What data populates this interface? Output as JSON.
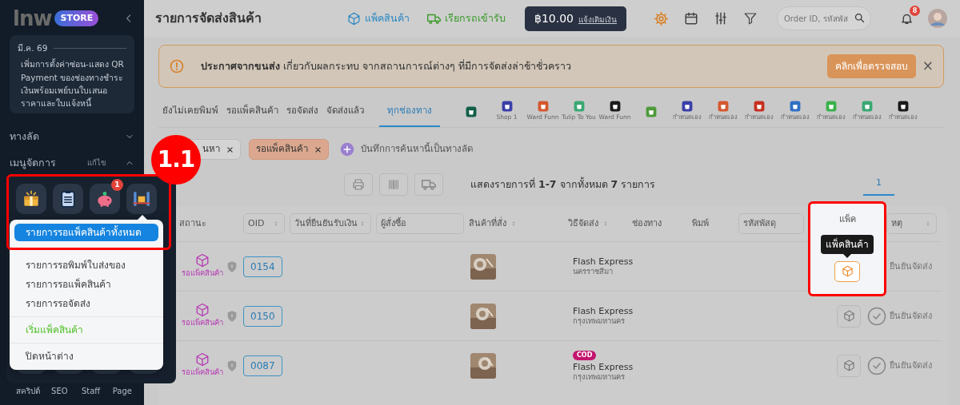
{
  "sidebar": {
    "logo": {
      "wordmark": "lnw",
      "badge": "STORE"
    },
    "news": {
      "date": "มี.ค. 69",
      "text": "เพิ่มการตั้งค่าซ่อน-แสดง QR Payment ของช่องทางชำระเงินพร้อมเพย์บนใบเสนอราคาและใบแจ้งหนี้"
    },
    "sections": [
      {
        "label": "ทางลัด",
        "expanded": false
      },
      {
        "label": "เมนูจัดการ",
        "action": "แก้ไข",
        "expanded": true
      }
    ],
    "menu_tiles": [
      {
        "kind": "gift"
      },
      {
        "kind": "clipboard"
      },
      {
        "kind": "piggy",
        "badge": "1"
      },
      {
        "kind": "station"
      }
    ],
    "bottom_items": [
      {
        "label": "สคริปต์"
      },
      {
        "label": "SEO"
      },
      {
        "label": "Staff"
      },
      {
        "label": "Page"
      }
    ]
  },
  "popup_menu": [
    {
      "label": "รายการรอแพ็คสินค้าทั้งหมด",
      "kind": "item",
      "selected": true
    },
    {
      "label": "รายการรอพิมพ์ใบส่งของ",
      "kind": "item",
      "selected": false
    },
    {
      "label": "รายการรอแพ็คสินค้า",
      "kind": "item",
      "selected": false
    },
    {
      "label": "รายการรอจัดส่ง",
      "kind": "item",
      "selected": false
    },
    {
      "label": "เริ่มแพ็คสินค้า",
      "kind": "action",
      "selected": false
    },
    {
      "label": "ปิดหน้าต่าง",
      "kind": "close",
      "selected": false
    }
  ],
  "callout": {
    "label": "1.1"
  },
  "header": {
    "title": "รายการจัดส่งสินค้า",
    "links": [
      {
        "label": "แพ็คสินค้า",
        "kind": "pack"
      },
      {
        "label": "เรียกรถเข้ารับ",
        "kind": "pickup"
      }
    ],
    "balance": {
      "amount": "฿10.00",
      "action": "แจ้งเติมเงิน"
    },
    "search": {
      "placeholder": "Order ID, รหัสพัส"
    },
    "notifications": "8"
  },
  "banner": {
    "text": "**ประกาศจากขนส่ง** เกี่ยวกับผลกระทบ จากสถานการณ์ต่างๆ ที่มีการจัดส่งล่าช้าชั่วคราว",
    "button": "คลิกเพื่อตรวจสอบ",
    "close": "×"
  },
  "status_tabs": [
    {
      "label": "ยังไม่เคยพิมพ์",
      "selected": false
    },
    {
      "label": "รอแพ็คสินค้า",
      "selected": false
    },
    {
      "label": "รอจัดส่ง",
      "selected": false
    },
    {
      "label": "จัดส่งแล้ว",
      "selected": false
    },
    {
      "label": "ทุกช่องทาง",
      "selected": true
    }
  ],
  "channel_tabs": [
    {
      "color": "#135e49",
      "selected": false
    },
    {
      "label": "Shop 1",
      "color": "#3b3fa8",
      "selected": false
    },
    {
      "label": "Ward Funn",
      "color": "#d4582f",
      "selected": false
    },
    {
      "label": "Tulip To You",
      "color": "#3aa872",
      "selected": false
    },
    {
      "label": "Ward Funn",
      "color": "#1a1a1a",
      "selected": false
    },
    {
      "color": "#4f9a3c",
      "selected": false
    },
    {
      "label": "กำหนดเอง",
      "color": "#3b3fa8",
      "selected": false
    },
    {
      "label": "กำหนดเอง",
      "color": "#d4582f",
      "selected": false
    },
    {
      "label": "กำหนดเอง",
      "color": "#c7301f",
      "selected": false
    },
    {
      "label": "กำหนดเอง",
      "color": "#2d6fc4",
      "selected": false
    },
    {
      "label": "กำหนดเอง",
      "color": "#3bb24c",
      "selected": false
    },
    {
      "label": "กำหนดเอง",
      "color": "#3aa872",
      "selected": false
    },
    {
      "label": "กำหนดเอง",
      "color": "#1a1a1a",
      "selected": false
    }
  ],
  "filters": {
    "chips": [
      {
        "label": "นหา",
        "kind": "plain"
      },
      {
        "label": "รอแพ็คสินค้า",
        "kind": "status"
      }
    ],
    "save_shortcut": "บันทึกการค้นหานี้เป็นทางลัด"
  },
  "toolbar": {
    "summary": "แสดงรายการที่ **1-7** จากทั้งหมด **7** รายการ",
    "pages": [
      {
        "label": "1",
        "selected": true
      }
    ]
  },
  "table": {
    "columns": [
      {
        "label": "สถานะ",
        "kind": "plain"
      },
      {
        "label": "OID",
        "kind": "sort-box"
      },
      {
        "label": "วันที่ยืนยันรับเงิน",
        "kind": "sort-box"
      },
      {
        "label": "ผู้สั่งซื้อ",
        "kind": "filter"
      },
      {
        "label": "สินค้าที่สั่ง",
        "kind": "sort"
      },
      {
        "label": "วิธีจัดส่ง",
        "kind": "sort"
      },
      {
        "label": "ช่องทาง",
        "kind": "plain"
      },
      {
        "label": "พิมพ์",
        "kind": "plain"
      },
      {
        "label": "รหัสพัสดุ",
        "kind": "filter"
      },
      {
        "label": "หตุ",
        "kind": "sort-box"
      }
    ],
    "rows": [
      {
        "status": "รอแพ็คสินค้า",
        "oid": "0154",
        "carrier": "Flash Express",
        "area": "นครราชสีมา",
        "confirm": "ยืนยันจัดส่ง",
        "spotlight": true
      },
      {
        "status": "รอแพ็คสินค้า",
        "oid": "0150",
        "carrier": "Flash Express",
        "area": "กรุงเทพมหานคร",
        "confirm": "ยืนยันจัดส่ง",
        "spotlight": false
      },
      {
        "status": "รอแพ็คสินค้า",
        "oid": "0087",
        "badge": "COD",
        "carrier": "Flash Express",
        "area": "กรุงเทพมหานคร",
        "confirm": "ยืนยันจัดส่ง",
        "spotlight": false
      }
    ]
  },
  "spotlight": {
    "header": "แพ็ค",
    "tooltip": "แพ็คสินค้า"
  }
}
